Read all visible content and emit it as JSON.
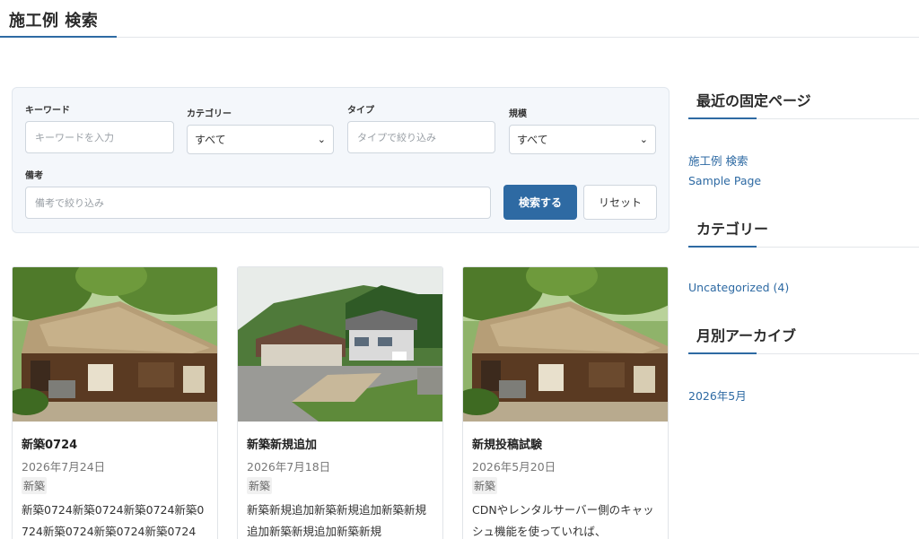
{
  "header": {
    "title": "施工例 検索"
  },
  "search": {
    "keyword": {
      "label": "キーワード",
      "placeholder": "キーワードを入力"
    },
    "category": {
      "label": "カテゴリー",
      "value": "すべて"
    },
    "type": {
      "label": "タイプ",
      "placeholder": "タイプで絞り込み"
    },
    "scale": {
      "label": "規模",
      "value": "すべて"
    },
    "remarks": {
      "label": "備考",
      "placeholder": "備考で絞り込み"
    },
    "submit_label": "検索する",
    "reset_label": "リセット"
  },
  "cards": [
    {
      "title": "新築0724",
      "date": "2026年7月24日",
      "tag": "新築",
      "excerpt": "新築0724新築0724新築0724新築0724新築0724新築0724新築0724"
    },
    {
      "title": "新築新規追加",
      "date": "2026年7月18日",
      "tag": "新築",
      "excerpt": "新築新規追加新築新規追加新築新規追加新築新規追加新築新規"
    },
    {
      "title": "新規投稿試験",
      "date": "2026年5月20日",
      "tag": "新築",
      "excerpt": "CDNやレンタルサーバー側のキャッシュ機能を使っていれば、"
    }
  ],
  "sidebar": {
    "recent_pages": {
      "heading": "最近の固定ページ",
      "items": [
        "施工例 検索",
        "Sample Page"
      ]
    },
    "categories": {
      "heading": "カテゴリー",
      "items": [
        "Uncategorized (4)"
      ]
    },
    "archives": {
      "heading": "月別アーカイブ",
      "items": [
        "2026年5月"
      ]
    }
  },
  "colors": {
    "accent": "#2e6aa3"
  }
}
